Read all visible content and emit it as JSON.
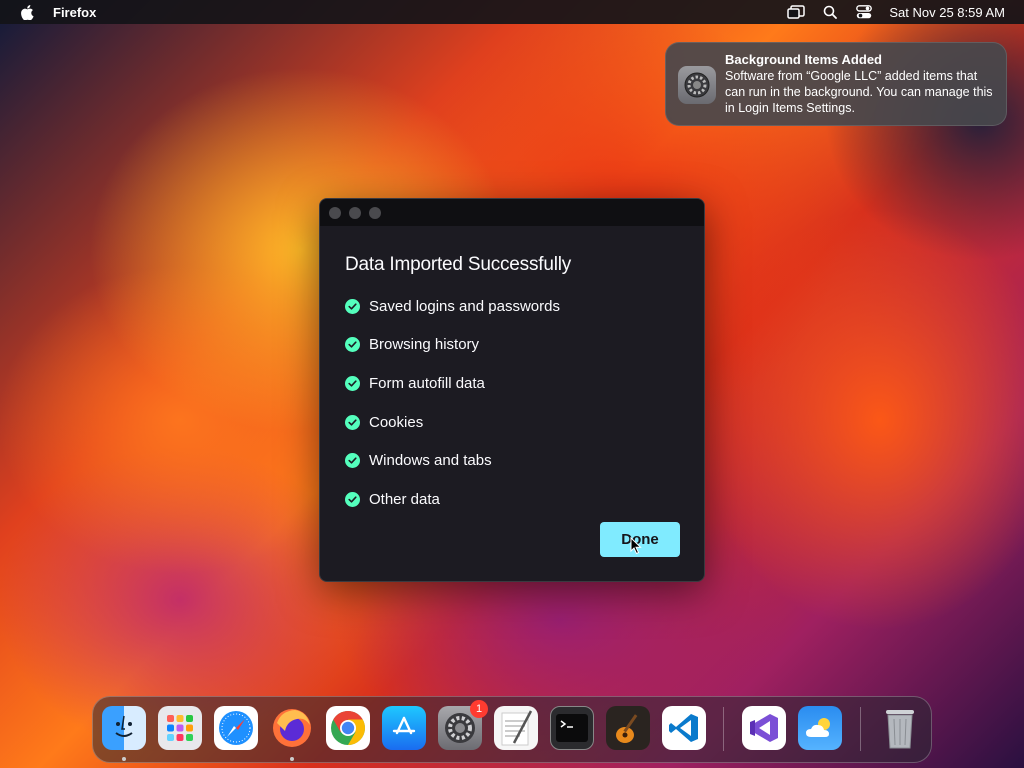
{
  "menubar": {
    "app_name": "Firefox",
    "clock": "Sat Nov 25  8:59 AM",
    "icons": [
      "apple-icon",
      "screen-mirroring-icon",
      "spotlight-search-icon",
      "control-center-icon"
    ]
  },
  "notification": {
    "title": "Background Items Added",
    "body": "Software from “Google LLC” added items that can run in the background. You can manage this in Login Items Settings.",
    "icon": "system-settings-icon"
  },
  "dialog": {
    "title": "Data Imported Successfully",
    "items": [
      "Saved logins and passwords",
      "Browsing history",
      "Form autofill data",
      "Cookies",
      "Windows and tabs",
      "Other data"
    ],
    "done_label": "Done",
    "colors": {
      "accent": "#80ebff",
      "check": "#54ffbd",
      "background": "#1c1b22"
    }
  },
  "dock": {
    "apps": [
      {
        "name": "finder",
        "running": true
      },
      {
        "name": "launchpad",
        "running": false
      },
      {
        "name": "safari",
        "running": false
      },
      {
        "name": "firefox",
        "running": true
      },
      {
        "name": "chrome",
        "running": false
      },
      {
        "name": "app-store",
        "running": false
      },
      {
        "name": "system-settings",
        "running": false,
        "badge": "1"
      },
      {
        "name": "textedit",
        "running": false
      },
      {
        "name": "terminal",
        "running": false
      },
      {
        "name": "garageband",
        "running": false
      },
      {
        "name": "vscode",
        "running": false
      },
      {
        "name": "visual-studio",
        "running": false
      },
      {
        "name": "weather",
        "running": false
      },
      {
        "name": "trash",
        "running": false
      }
    ]
  }
}
